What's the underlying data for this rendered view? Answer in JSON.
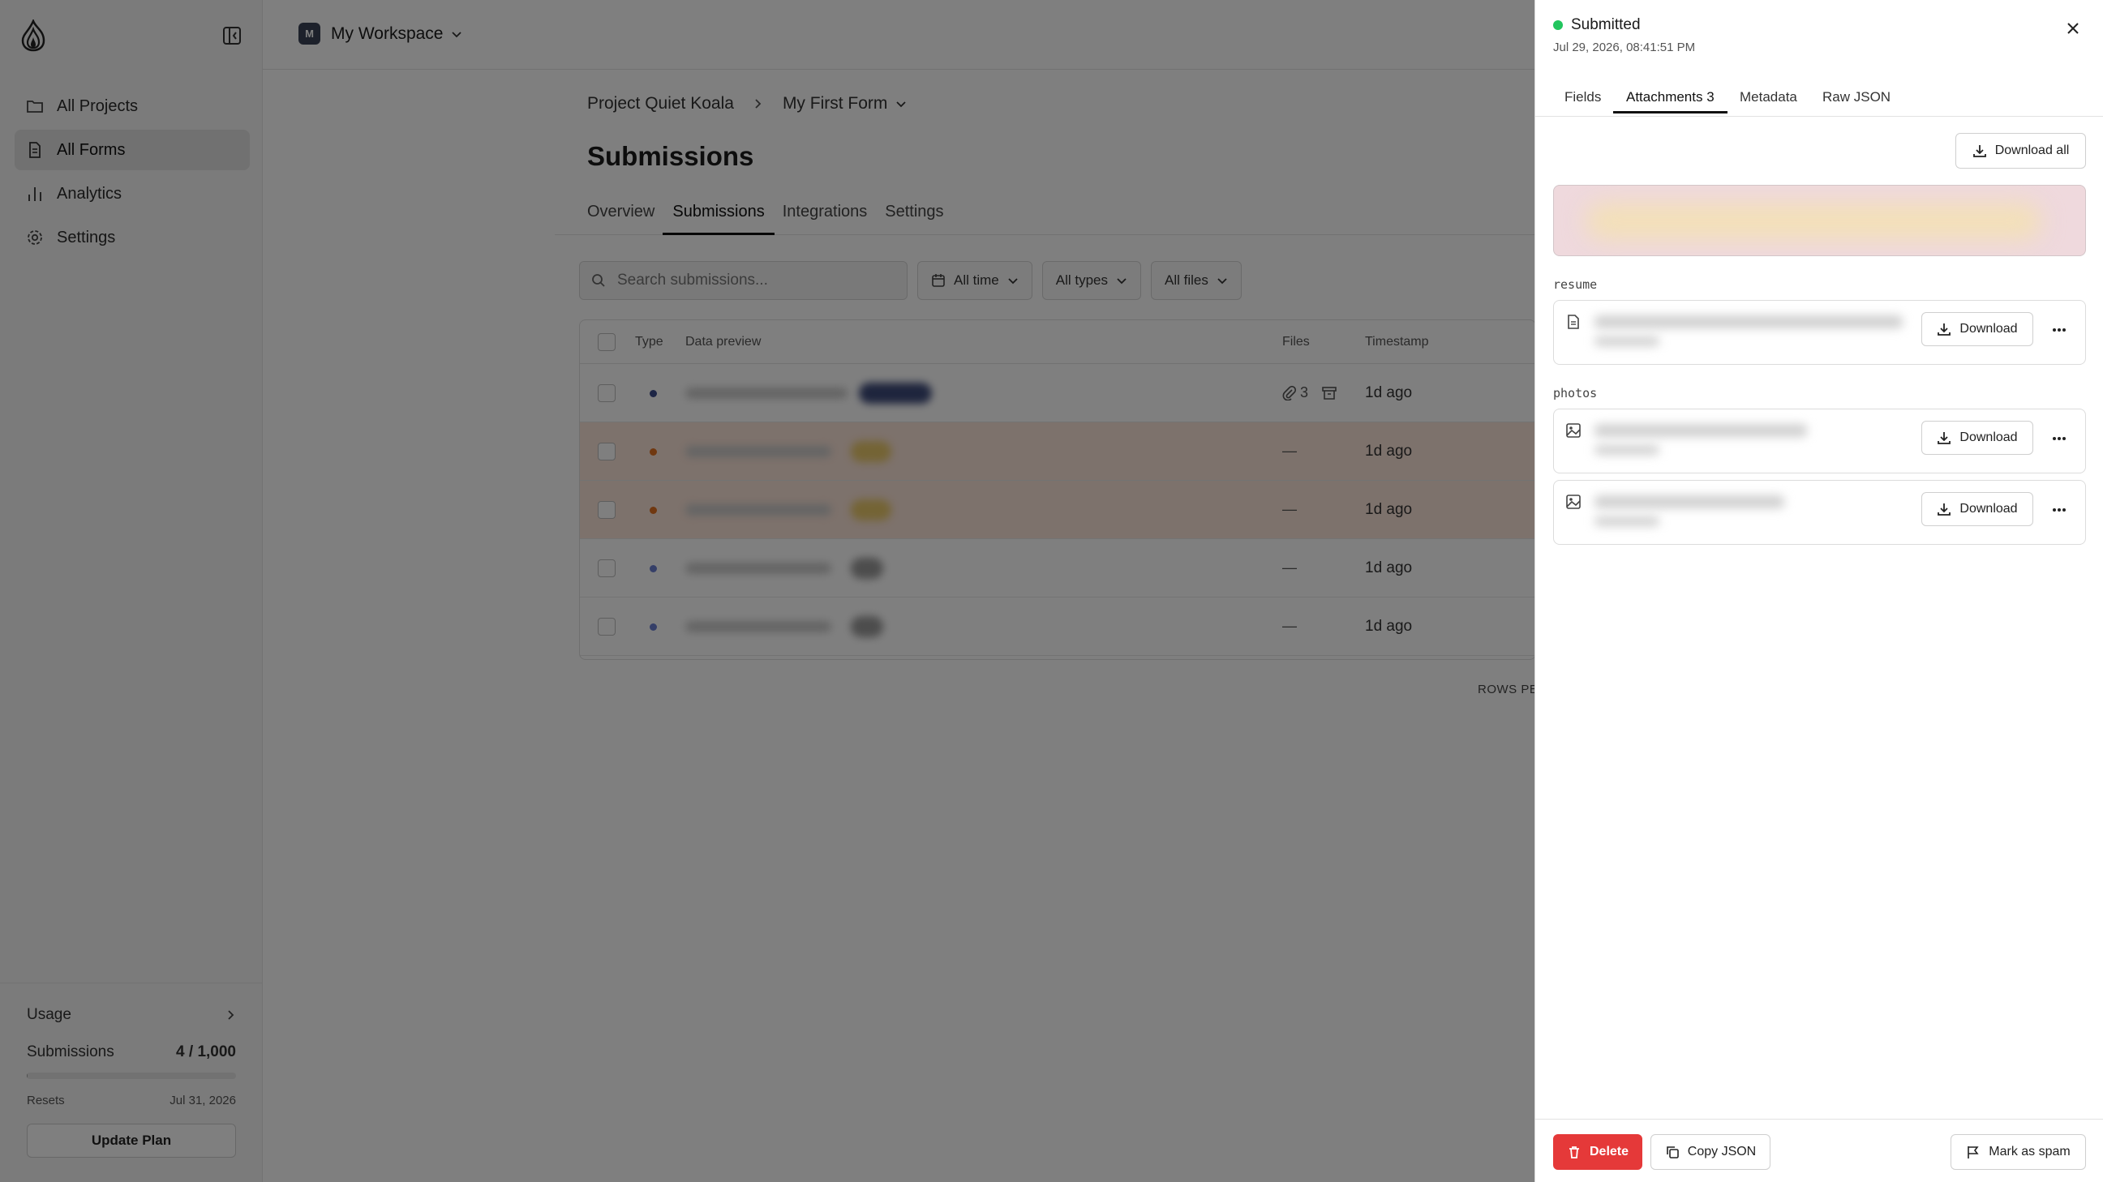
{
  "sidebar": {
    "items": [
      {
        "label": "All Projects",
        "icon": "folder-icon"
      },
      {
        "label": "All Forms",
        "icon": "file-text-icon"
      },
      {
        "label": "Analytics",
        "icon": "bar-chart-icon"
      },
      {
        "label": "Settings",
        "icon": "gear-icon"
      }
    ],
    "usage": {
      "title": "Usage",
      "submissions_label": "Submissions",
      "submissions_value": "4 / 1,000",
      "progress": 0.004,
      "resets_label": "Resets",
      "resets_date": "Jul 31, 2026",
      "update_label": "Update Plan"
    }
  },
  "header": {
    "workspace_initial": "M",
    "workspace_name": "My Workspace"
  },
  "breadcrumb": {
    "project": "Project Quiet Koala",
    "form": "My First Form"
  },
  "page": {
    "title": "Submissions",
    "tabs": [
      "Overview",
      "Submissions",
      "Integrations",
      "Settings"
    ],
    "active_tab": "Submissions"
  },
  "filters": {
    "search_placeholder": "Search submissions...",
    "time": "All time",
    "types": "All types",
    "files": "All files"
  },
  "table": {
    "columns": {
      "type": "Type",
      "preview": "Data preview",
      "files": "Files",
      "timestamp": "Timestamp"
    },
    "rows": [
      {
        "dot_color": "#3b4a8a",
        "files": "3",
        "has_files": true,
        "timestamp": "1d ago",
        "spam": false
      },
      {
        "dot_color": "#e07020",
        "files": "—",
        "has_files": false,
        "timestamp": "1d ago",
        "spam": true
      },
      {
        "dot_color": "#e07020",
        "files": "—",
        "has_files": false,
        "timestamp": "1d ago",
        "spam": true
      },
      {
        "dot_color": "#6b7fd0",
        "files": "—",
        "has_files": false,
        "timestamp": "1d ago",
        "spam": false
      },
      {
        "dot_color": "#6b7fd0",
        "files": "—",
        "has_files": false,
        "timestamp": "1d ago",
        "spam": false
      }
    ],
    "rows_per_page_label": "ROWS PE"
  },
  "drawer": {
    "status": "Submitted",
    "status_color": "#22c55e",
    "date": "Jul 29, 2026, 08:41:51 PM",
    "tabs": [
      "Fields",
      "Attachments 3",
      "Metadata",
      "Raw JSON"
    ],
    "active_tab": "Attachments 3",
    "download_all_label": "Download all",
    "sections": [
      {
        "label": "resume",
        "files": [
          {
            "icon": "file-icon",
            "download_label": "Download"
          }
        ]
      },
      {
        "label": "photos",
        "files": [
          {
            "icon": "image-icon",
            "download_label": "Download"
          },
          {
            "icon": "image-icon",
            "download_label": "Download"
          }
        ]
      }
    ],
    "footer": {
      "delete_label": "Delete",
      "copy_json_label": "Copy JSON",
      "mark_spam_label": "Mark as spam"
    }
  },
  "colors": {
    "accent_danger": "#e53939",
    "spam_row": "#fbe4d8",
    "workspace_avatar": "#3b4257"
  }
}
